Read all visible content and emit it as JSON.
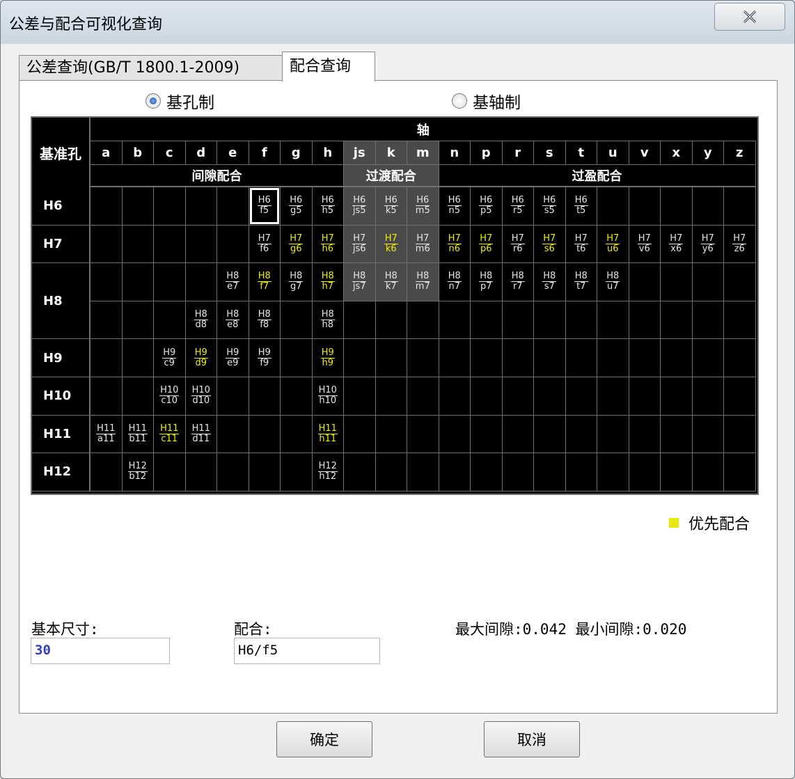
{
  "window": {
    "title": "公差与配合可视化查询"
  },
  "tabs": [
    {
      "label": "公差查询(GB/T 1800.1-2009)"
    },
    {
      "label": "配合查询"
    }
  ],
  "radios": [
    {
      "label": "基孔制",
      "selected": true
    },
    {
      "label": "基轴制",
      "selected": false
    }
  ],
  "table": {
    "corner": "基准孔",
    "shaft_header": "轴",
    "shafts": [
      "a",
      "b",
      "c",
      "d",
      "e",
      "f",
      "g",
      "h",
      "js",
      "k",
      "m",
      "n",
      "p",
      "r",
      "s",
      "t",
      "u",
      "v",
      "x",
      "y",
      "z"
    ],
    "groups": [
      {
        "label": "间隙配合",
        "from": 0,
        "to": 7
      },
      {
        "label": "过渡配合",
        "from": 8,
        "to": 10
      },
      {
        "label": "过盈配合",
        "from": 11,
        "to": 20
      }
    ],
    "holes": [
      {
        "label": "H6",
        "rows": [
          [
            {
              "c": 5,
              "n": "H6",
              "d": "f5",
              "sel": true
            },
            {
              "c": 6,
              "n": "H6",
              "d": "g5"
            },
            {
              "c": 7,
              "n": "H6",
              "d": "h5"
            },
            {
              "c": 8,
              "n": "H6",
              "d": "js5"
            },
            {
              "c": 9,
              "n": "H6",
              "d": "k5"
            },
            {
              "c": 10,
              "n": "H6",
              "d": "m5"
            },
            {
              "c": 11,
              "n": "H6",
              "d": "n5"
            },
            {
              "c": 12,
              "n": "H6",
              "d": "p5"
            },
            {
              "c": 13,
              "n": "H6",
              "d": "r5"
            },
            {
              "c": 14,
              "n": "H6",
              "d": "s5"
            },
            {
              "c": 15,
              "n": "H6",
              "d": "t5"
            }
          ]
        ]
      },
      {
        "label": "H7",
        "rows": [
          [
            {
              "c": 5,
              "n": "H7",
              "d": "f6"
            },
            {
              "c": 6,
              "n": "H7",
              "d": "g6",
              "p": true
            },
            {
              "c": 7,
              "n": "H7",
              "d": "h6",
              "p": true
            },
            {
              "c": 8,
              "n": "H7",
              "d": "js6"
            },
            {
              "c": 9,
              "n": "H7",
              "d": "k6",
              "p": true
            },
            {
              "c": 10,
              "n": "H7",
              "d": "m6"
            },
            {
              "c": 11,
              "n": "H7",
              "d": "n6",
              "p": true
            },
            {
              "c": 12,
              "n": "H7",
              "d": "p6",
              "p": true
            },
            {
              "c": 13,
              "n": "H7",
              "d": "r6"
            },
            {
              "c": 14,
              "n": "H7",
              "d": "s6",
              "p": true
            },
            {
              "c": 15,
              "n": "H7",
              "d": "t6"
            },
            {
              "c": 16,
              "n": "H7",
              "d": "u6",
              "p": true
            },
            {
              "c": 17,
              "n": "H7",
              "d": "v6"
            },
            {
              "c": 18,
              "n": "H7",
              "d": "x6"
            },
            {
              "c": 19,
              "n": "H7",
              "d": "y6"
            },
            {
              "c": 20,
              "n": "H7",
              "d": "z6"
            }
          ]
        ]
      },
      {
        "label": "H8",
        "rows": [
          [
            {
              "c": 4,
              "n": "H8",
              "d": "e7"
            },
            {
              "c": 5,
              "n": "H8",
              "d": "f7",
              "p": true
            },
            {
              "c": 6,
              "n": "H8",
              "d": "g7"
            },
            {
              "c": 7,
              "n": "H8",
              "d": "h7",
              "p": true
            },
            {
              "c": 8,
              "n": "H8",
              "d": "js7"
            },
            {
              "c": 9,
              "n": "H8",
              "d": "k7"
            },
            {
              "c": 10,
              "n": "H8",
              "d": "m7"
            },
            {
              "c": 11,
              "n": "H8",
              "d": "n7"
            },
            {
              "c": 12,
              "n": "H8",
              "d": "p7"
            },
            {
              "c": 13,
              "n": "H8",
              "d": "r7"
            },
            {
              "c": 14,
              "n": "H8",
              "d": "s7"
            },
            {
              "c": 15,
              "n": "H8",
              "d": "t7"
            },
            {
              "c": 16,
              "n": "H8",
              "d": "u7"
            }
          ],
          [
            {
              "c": 3,
              "n": "H8",
              "d": "d8"
            },
            {
              "c": 4,
              "n": "H8",
              "d": "e8"
            },
            {
              "c": 5,
              "n": "H8",
              "d": "f8"
            },
            {
              "c": 7,
              "n": "H8",
              "d": "h8"
            }
          ]
        ]
      },
      {
        "label": "H9",
        "rows": [
          [
            {
              "c": 2,
              "n": "H9",
              "d": "c9"
            },
            {
              "c": 3,
              "n": "H9",
              "d": "d9",
              "p": true
            },
            {
              "c": 4,
              "n": "H9",
              "d": "e9"
            },
            {
              "c": 5,
              "n": "H9",
              "d": "f9"
            },
            {
              "c": 7,
              "n": "H9",
              "d": "h9",
              "p": true
            }
          ]
        ]
      },
      {
        "label": "H10",
        "rows": [
          [
            {
              "c": 2,
              "n": "H10",
              "d": "c10"
            },
            {
              "c": 3,
              "n": "H10",
              "d": "d10"
            },
            {
              "c": 7,
              "n": "H10",
              "d": "h10"
            }
          ]
        ]
      },
      {
        "label": "H11",
        "rows": [
          [
            {
              "c": 0,
              "n": "H11",
              "d": "a11"
            },
            {
              "c": 1,
              "n": "H11",
              "d": "b11"
            },
            {
              "c": 2,
              "n": "H11",
              "d": "c11",
              "p": true
            },
            {
              "c": 3,
              "n": "H11",
              "d": "d11"
            },
            {
              "c": 7,
              "n": "H11",
              "d": "h11",
              "p": true
            }
          ]
        ]
      },
      {
        "label": "H12",
        "rows": [
          [
            {
              "c": 1,
              "n": "H12",
              "d": "b12"
            },
            {
              "c": 7,
              "n": "H12",
              "d": "h12"
            }
          ]
        ]
      }
    ]
  },
  "colors": {
    "priority": "#f2ee00",
    "transition_bg": "#4a4a4a",
    "grid_bg": "#000000"
  },
  "legend": {
    "label": "优先配合"
  },
  "form": {
    "basic_size_label": "基本尺寸:",
    "basic_size_value": "30",
    "fit_label": "配合:",
    "fit_value": "H6/f5",
    "result": "最大间隙:0.042 最小间隙:0.020"
  },
  "buttons": {
    "ok": "确定",
    "cancel": "取消"
  }
}
